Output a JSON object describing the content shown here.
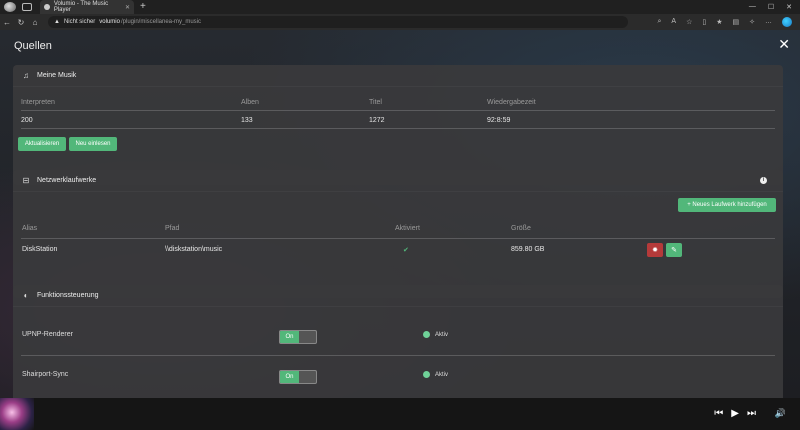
{
  "browser": {
    "tab_title": "Volumio - The Music Player",
    "security_label": "Nicht sicher",
    "url_host": "volumio",
    "url_path": "/plugin/miscellanea-my_music"
  },
  "page": {
    "title": "Quellen"
  },
  "meine_musik": {
    "title": "Meine Musik",
    "headers": [
      "Interpreten",
      "Alben",
      "Titel",
      "Wiedergabezeit"
    ],
    "values": [
      "200",
      "133",
      "1272",
      "92:8:59"
    ],
    "buttons": [
      "Aktualisieren",
      "Neu einlesen"
    ]
  },
  "netzwerk": {
    "title": "Netzwerklaufwerke",
    "add_button": "+ Neues Laufwerk hinzufügen",
    "headers": [
      "Alias",
      "Pfad",
      "Aktiviert",
      "Größe"
    ],
    "row": {
      "alias": "DiskStation",
      "pfad": "\\\\diskstation\\music",
      "aktiviert": "✔",
      "groesse": "859.80 GB"
    }
  },
  "funktion": {
    "title": "Funktionssteuerung",
    "items": [
      {
        "label": "UPNP-Renderer",
        "toggle": "On",
        "status": "Aktiv"
      },
      {
        "label": "Shairport-Sync",
        "toggle": "On",
        "status": "Aktiv"
      }
    ]
  },
  "colors": {
    "accent": "#52b77a",
    "danger": "#b53a3a",
    "panel": "#3a3a3c"
  },
  "icons": [
    "music-note-icon",
    "drive-icon",
    "toggle-icon",
    "info-icon",
    "trash-icon",
    "edit-icon",
    "close-icon",
    "previous-icon",
    "play-icon",
    "next-icon",
    "volume-icon"
  ]
}
